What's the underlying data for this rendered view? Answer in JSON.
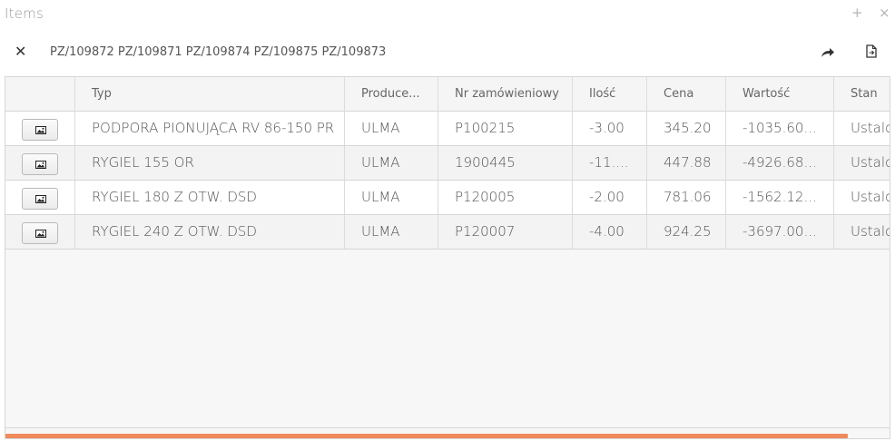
{
  "window": {
    "title": "Items",
    "add_glyph": "+",
    "close_glyph": "×"
  },
  "toolbar": {
    "close_glyph": "✕",
    "documents": "PZ/109872 PZ/109871 PZ/109874 PZ/109875 PZ/109873",
    "share_icon": "share-arrow-icon",
    "export_icon": "document-export-icon"
  },
  "grid": {
    "columns": [
      "",
      "Typ",
      "Produce...",
      "Nr zamówieniowy",
      "Ilość",
      "Cena",
      "Wartość",
      "Stan"
    ],
    "rows": [
      {
        "typ": "PODPORA PIONUJĄCA RV 86-150 PR",
        "producer": "ULMA",
        "order_no": "P100215",
        "qty": "-3.00",
        "price": "345.20",
        "value": "-1035.60...",
        "state": "Ustalo"
      },
      {
        "typ": "RYGIEL 155 OR",
        "producer": "ULMA",
        "order_no": "1900445",
        "qty": "-11....",
        "price": "447.88",
        "value": "-4926.68...",
        "state": "Ustalo"
      },
      {
        "typ": "RYGIEL 180 Z OTW. DSD",
        "producer": "ULMA",
        "order_no": "P120005",
        "qty": "-2.00",
        "price": "781.06",
        "value": "-1562.12...",
        "state": "Ustalo"
      },
      {
        "typ": "RYGIEL 240 Z OTW. DSD",
        "producer": "ULMA",
        "order_no": "P120007",
        "qty": "-4.00",
        "price": "924.25",
        "value": "-3697.00...",
        "state": "Ustalo"
      }
    ]
  },
  "colors": {
    "scroll_thumb": "#f08a5d",
    "row_alt": "#f3f3f3"
  }
}
